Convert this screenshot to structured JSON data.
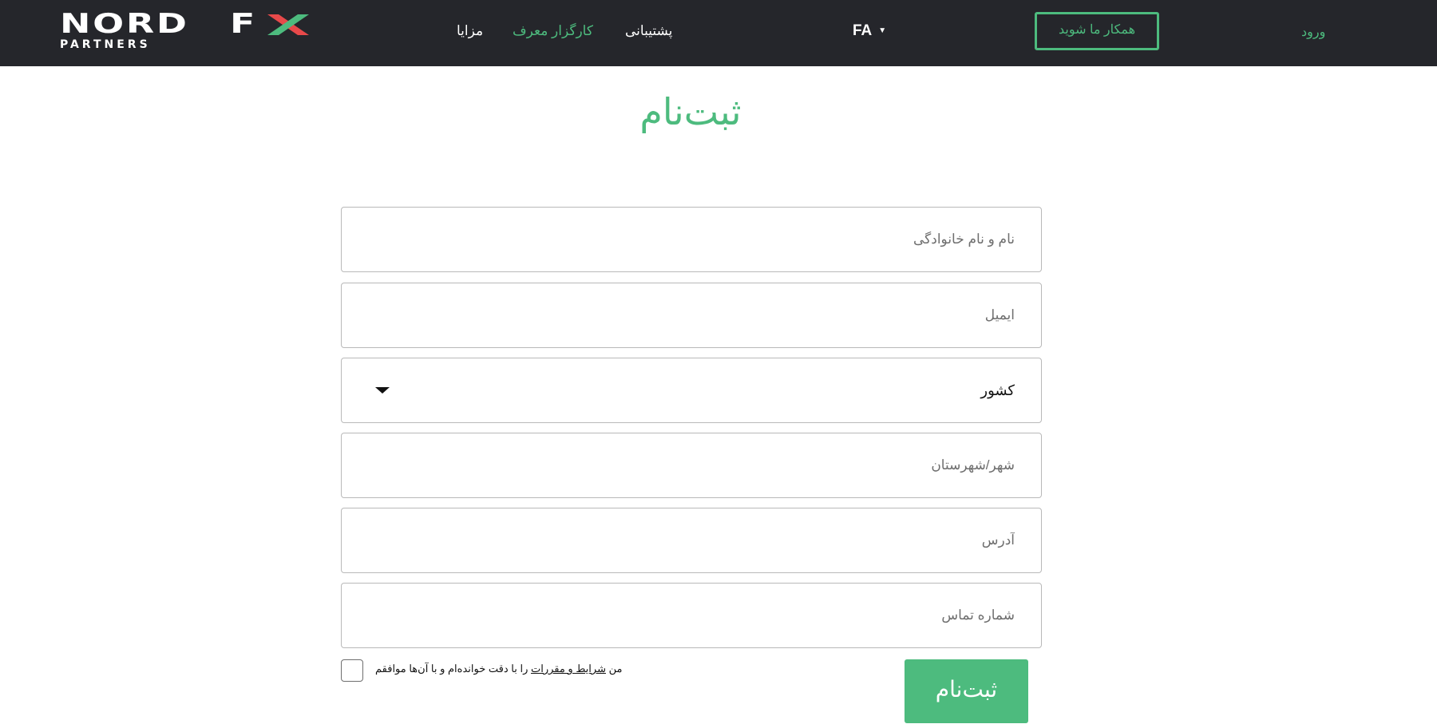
{
  "header": {
    "logo": {
      "main": "NORD FX",
      "sub": "PARTNERS"
    },
    "nav": {
      "benefits": "مزایا",
      "referral_broker": "کارگزار معرف",
      "support": "پشتیبانی"
    },
    "language": {
      "current": "FA",
      "caret": "▼"
    },
    "partner_button": "همکار ما شوید",
    "login": "ورود"
  },
  "page": {
    "title": "ثبت‌نام"
  },
  "form": {
    "full_name_placeholder": "نام و نام خانوادگی",
    "email_placeholder": "ایمیل",
    "country_value": "کشور",
    "city_placeholder": "شهر/شهرستان",
    "address_placeholder": "آدرس",
    "phone_placeholder": "شماره تماس",
    "terms": {
      "prefix": "من ",
      "link": "شرایط و مقررات",
      "suffix": " را با دقت خوانده‌ام و با آن‌ها موافقم"
    },
    "submit_label": "ثبت‌نام"
  },
  "colors": {
    "accent": "#4dbb7e",
    "logo_x": "#e8494a",
    "header_bg": "#25262b"
  }
}
